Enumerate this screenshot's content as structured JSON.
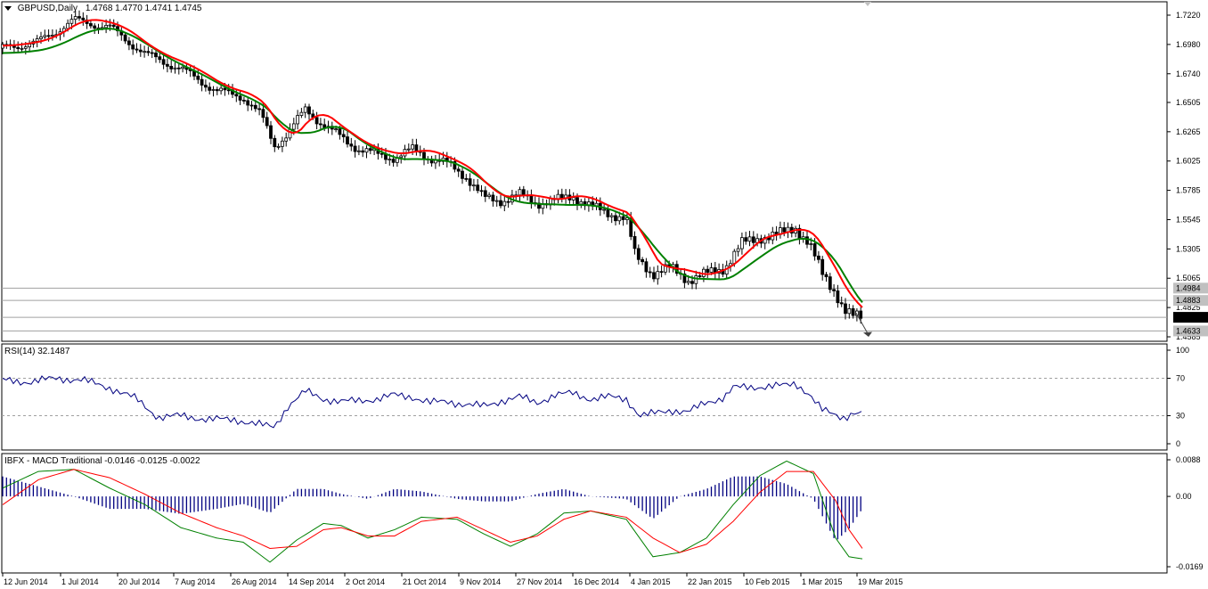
{
  "main": {
    "symbol": "GBPUSD,Daily",
    "ohlc": "1.4768 1.4770 1.4741 1.4745",
    "price_axis": [
      "1.7220",
      "1.6980",
      "1.6740",
      "1.6505",
      "1.6265",
      "1.6025",
      "1.5785",
      "1.5545",
      "1.5305",
      "1.5065",
      "1.4825",
      "1.4585"
    ],
    "badges": [
      {
        "text": "1.4984",
        "price": 1.4984,
        "bg": "#c0c0c0"
      },
      {
        "text": "1.4883",
        "price": 1.4883,
        "bg": "#c0c0c0"
      },
      {
        "text": "1.4745",
        "price": 1.4745,
        "bg": "#000000"
      },
      {
        "text": "1.4633",
        "price": 1.4633,
        "bg": "#c0c0c0"
      }
    ],
    "hlines": [
      1.4984,
      1.4883,
      1.4745,
      1.4633
    ]
  },
  "rsi": {
    "label": "RSI(14) 32.1487",
    "axis": [
      "100",
      "70",
      "30",
      "0"
    ]
  },
  "macd": {
    "label": "IBFX - MACD Traditional -0.0146 -0.0125 -0.0022",
    "axis": [
      "0.0088",
      "0.00",
      "-0.0169"
    ]
  },
  "dates": [
    "12 Jun 2014",
    "1 Jul 2014",
    "20 Jul 2014",
    "7 Aug 2014",
    "26 Aug 2014",
    "14 Sep 2014",
    "2 Oct 2014",
    "21 Oct 2014",
    "9 Nov 2014",
    "27 Nov 2014",
    "16 Dec 2014",
    "4 Jan 2015",
    "22 Jan 2015",
    "10 Feb 2015",
    "1 Mar 2015",
    "19 Mar 2015"
  ],
  "colors": {
    "ma_fast": "#008000",
    "ma_slow": "#ff0000",
    "rsi": "#000080",
    "macd_hist": "#000080",
    "macd_line": "#008000",
    "signal_line": "#ff0000"
  },
  "chart_data": [
    {
      "type": "candlestick",
      "title": "GBPUSD,Daily",
      "ylim": [
        1.4585,
        1.722
      ],
      "close_path": [
        [
          0,
          1.695
        ],
        [
          40,
          1.7
        ],
        [
          80,
          1.718
        ],
        [
          120,
          1.712
        ],
        [
          160,
          1.69
        ],
        [
          200,
          1.678
        ],
        [
          240,
          1.66
        ],
        [
          270,
          1.655
        ],
        [
          290,
          1.64
        ],
        [
          305,
          1.615
        ],
        [
          320,
          1.625
        ],
        [
          340,
          1.645
        ],
        [
          360,
          1.632
        ],
        [
          380,
          1.622
        ],
        [
          400,
          1.612
        ],
        [
          420,
          1.608
        ],
        [
          440,
          1.605
        ],
        [
          460,
          1.612
        ],
        [
          480,
          1.605
        ],
        [
          500,
          1.6
        ],
        [
          520,
          1.59
        ],
        [
          540,
          1.572
        ],
        [
          560,
          1.57
        ],
        [
          580,
          1.575
        ],
        [
          600,
          1.568
        ],
        [
          620,
          1.57
        ],
        [
          640,
          1.574
        ],
        [
          660,
          1.565
        ],
        [
          680,
          1.56
        ],
        [
          700,
          1.555
        ],
        [
          710,
          1.525
        ],
        [
          730,
          1.51
        ],
        [
          750,
          1.515
        ],
        [
          770,
          1.505
        ],
        [
          790,
          1.51
        ],
        [
          810,
          1.515
        ],
        [
          830,
          1.535
        ],
        [
          850,
          1.54
        ],
        [
          870,
          1.542
        ],
        [
          890,
          1.548
        ],
        [
          905,
          1.535
        ],
        [
          920,
          1.51
        ],
        [
          935,
          1.495
        ],
        [
          945,
          1.48
        ],
        [
          955,
          1.475
        ],
        [
          965,
          1.4745
        ]
      ]
    },
    {
      "type": "line",
      "title": "RSI(14) 32.1487",
      "ylim": [
        0,
        100
      ],
      "values": [
        [
          0,
          68
        ],
        [
          30,
          66
        ],
        [
          60,
          70
        ],
        [
          90,
          68
        ],
        [
          120,
          60
        ],
        [
          150,
          48
        ],
        [
          175,
          28
        ],
        [
          200,
          30
        ],
        [
          230,
          26
        ],
        [
          260,
          26
        ],
        [
          290,
          20
        ],
        [
          305,
          18
        ],
        [
          320,
          40
        ],
        [
          340,
          56
        ],
        [
          360,
          48
        ],
        [
          380,
          45
        ],
        [
          400,
          46
        ],
        [
          420,
          48
        ],
        [
          440,
          52
        ],
        [
          460,
          50
        ],
        [
          480,
          44
        ],
        [
          500,
          45
        ],
        [
          520,
          42
        ],
        [
          540,
          40
        ],
        [
          560,
          46
        ],
        [
          580,
          50
        ],
        [
          600,
          44
        ],
        [
          620,
          52
        ],
        [
          640,
          54
        ],
        [
          660,
          48
        ],
        [
          680,
          50
        ],
        [
          700,
          48
        ],
        [
          715,
          30
        ],
        [
          730,
          32
        ],
        [
          750,
          36
        ],
        [
          770,
          34
        ],
        [
          790,
          44
        ],
        [
          810,
          50
        ],
        [
          820,
          60
        ],
        [
          840,
          60
        ],
        [
          860,
          62
        ],
        [
          880,
          62
        ],
        [
          890,
          64
        ],
        [
          905,
          54
        ],
        [
          920,
          36
        ],
        [
          935,
          30
        ],
        [
          945,
          28
        ],
        [
          955,
          34
        ],
        [
          965,
          32
        ]
      ]
    },
    {
      "type": "line",
      "title": "IBFX - MACD Traditional -0.0146 -0.0125 -0.0022",
      "ylim": [
        -0.0169,
        0.0088
      ],
      "series": [
        {
          "name": "MACD",
          "values": [
            [
              0,
              0.002
            ],
            [
              40,
              0.006
            ],
            [
              80,
              0.0065
            ],
            [
              120,
              0.002
            ],
            [
              160,
              -0.002
            ],
            [
              200,
              -0.0075
            ],
            [
              240,
              -0.01
            ],
            [
              270,
              -0.011
            ],
            [
              300,
              -0.0158
            ],
            [
              330,
              -0.0105
            ],
            [
              360,
              -0.0065
            ],
            [
              380,
              -0.007
            ],
            [
              410,
              -0.01
            ],
            [
              440,
              -0.008
            ],
            [
              470,
              -0.005
            ],
            [
              510,
              -0.0055
            ],
            [
              540,
              -0.009
            ],
            [
              570,
              -0.012
            ],
            [
              600,
              -0.009
            ],
            [
              630,
              -0.004
            ],
            [
              660,
              -0.0035
            ],
            [
              700,
              -0.0055
            ],
            [
              730,
              -0.0145
            ],
            [
              760,
              -0.0135
            ],
            [
              790,
              -0.01
            ],
            [
              820,
              -0.002
            ],
            [
              850,
              0.005
            ],
            [
              880,
              0.0085
            ],
            [
              910,
              0.0055
            ],
            [
              935,
              -0.01
            ],
            [
              950,
              -0.0145
            ],
            [
              965,
              -0.015
            ]
          ]
        },
        {
          "name": "Signal",
          "values": [
            [
              0,
              -0.002
            ],
            [
              40,
              0.004
            ],
            [
              80,
              0.0065
            ],
            [
              120,
              0.0045
            ],
            [
              160,
              0.0005
            ],
            [
              200,
              -0.004
            ],
            [
              240,
              -0.0075
            ],
            [
              270,
              -0.0095
            ],
            [
              300,
              -0.0125
            ],
            [
              330,
              -0.012
            ],
            [
              360,
              -0.008
            ],
            [
              380,
              -0.0075
            ],
            [
              410,
              -0.0095
            ],
            [
              440,
              -0.0095
            ],
            [
              470,
              -0.006
            ],
            [
              510,
              -0.005
            ],
            [
              540,
              -0.008
            ],
            [
              570,
              -0.011
            ],
            [
              600,
              -0.0095
            ],
            [
              630,
              -0.0055
            ],
            [
              660,
              -0.0035
            ],
            [
              700,
              -0.005
            ],
            [
              730,
              -0.01
            ],
            [
              760,
              -0.0135
            ],
            [
              790,
              -0.0115
            ],
            [
              820,
              -0.006
            ],
            [
              850,
              0.001
            ],
            [
              880,
              0.006
            ],
            [
              910,
              0.006
            ],
            [
              935,
              -0.001
            ],
            [
              950,
              -0.008
            ],
            [
              965,
              -0.0125
            ]
          ]
        }
      ]
    }
  ]
}
